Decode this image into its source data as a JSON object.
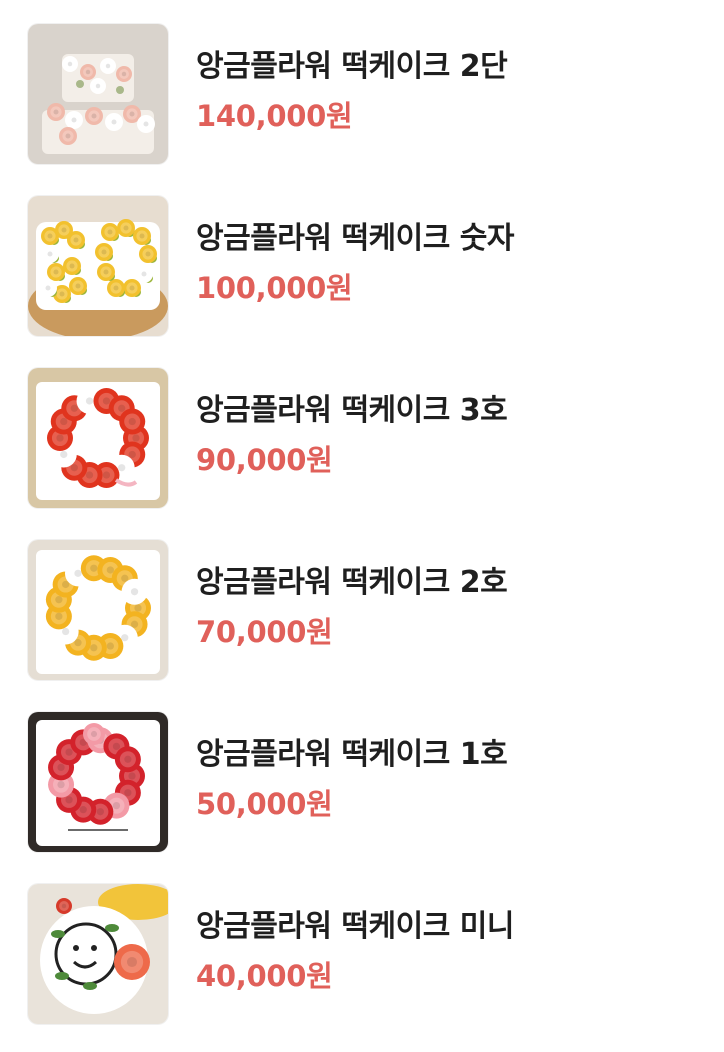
{
  "products": [
    {
      "name": "앙금플라워 떡케이크 2단",
      "price": "140,000원",
      "image_icon": "two-tier-pastel-flower-cake-photo",
      "colors": {
        "bg": "#d9d3cc",
        "base": "#f3eee8",
        "flower": "#f0b9aa",
        "flower2": "#ffffff",
        "leaf": "#a9b88a"
      }
    },
    {
      "name": "앙금플라워 떡케이크 숫자",
      "price": "100,000원",
      "image_icon": "number-shaped-yellow-flower-cake-photo",
      "colors": {
        "bg": "#e7ddd0",
        "base": "#c99a5e",
        "flower": "#f2c12e",
        "flower2": "#ffffff",
        "leaf": "#9bb53a"
      }
    },
    {
      "name": "앙금플라워 떡케이크 3호",
      "price": "90,000원",
      "image_icon": "red-rose-wreath-cake-photo",
      "colors": {
        "bg": "#d8c7a5",
        "base": "#ffffff",
        "flower": "#e0341e",
        "flower2": "#ffffff",
        "leaf": "#6f9e4a"
      }
    },
    {
      "name": "앙금플라워 떡케이크 2호",
      "price": "70,000원",
      "image_icon": "yellow-flower-wreath-cake-photo",
      "colors": {
        "bg": "#e5ded4",
        "base": "#ffffff",
        "flower": "#f3b320",
        "flower2": "#ffffff",
        "leaf": "#8ea83a"
      }
    },
    {
      "name": "앙금플라워 떡케이크 1호",
      "price": "50,000원",
      "image_icon": "red-pink-flower-wreath-cake-photo",
      "colors": {
        "bg": "#2f2a27",
        "base": "#ffffff",
        "flower": "#d3222b",
        "flower2": "#f39aa6",
        "leaf": "#6a8f48"
      }
    },
    {
      "name": "앙금플라워 떡케이크 미니",
      "price": "40,000원",
      "image_icon": "smiley-face-mini-cake-photo",
      "colors": {
        "bg": "#e9e3da",
        "base": "#ffffff",
        "flower": "#ee6a4a",
        "flower2": "#f2c43a",
        "leaf": "#4e8a3a"
      }
    }
  ]
}
